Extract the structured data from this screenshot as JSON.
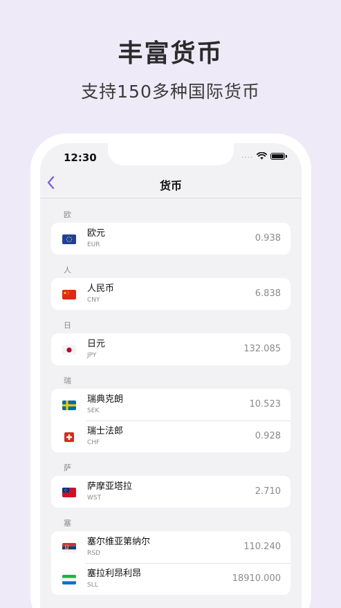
{
  "promo": {
    "title": "丰富货币",
    "subtitle": "支持150多种国际货币"
  },
  "status_bar": {
    "time": "12:30",
    "signal": "....",
    "icons": [
      "wifi-icon",
      "battery-icon"
    ]
  },
  "nav": {
    "title": "货币",
    "back_icon": "chevron-left-icon",
    "accent_color": "#7b61d8"
  },
  "sections": [
    {
      "header": "欧",
      "items": [
        {
          "name": "欧元",
          "code": "EUR",
          "rate": "0.938",
          "flag": "eu-flag-icon"
        }
      ]
    },
    {
      "header": "人",
      "items": [
        {
          "name": "人民币",
          "code": "CNY",
          "rate": "6.838",
          "flag": "china-flag-icon"
        }
      ]
    },
    {
      "header": "日",
      "items": [
        {
          "name": "日元",
          "code": "JPY",
          "rate": "132.085",
          "flag": "japan-flag-icon"
        }
      ]
    },
    {
      "header": "瑞",
      "items": [
        {
          "name": "瑞典克朗",
          "code": "SEK",
          "rate": "10.523",
          "flag": "sweden-flag-icon"
        },
        {
          "name": "瑞士法郎",
          "code": "CHF",
          "rate": "0.928",
          "flag": "switzerland-flag-icon"
        }
      ]
    },
    {
      "header": "萨",
      "items": [
        {
          "name": "萨摩亚塔拉",
          "code": "WST",
          "rate": "2.710",
          "flag": "samoa-flag-icon"
        }
      ]
    },
    {
      "header": "塞",
      "items": [
        {
          "name": "塞尔维亚第纳尔",
          "code": "RSD",
          "rate": "110.240",
          "flag": "serbia-flag-icon"
        },
        {
          "name": "塞拉利昂利昂",
          "code": "SLL",
          "rate": "18910.000",
          "flag": "sierra-leone-flag-icon"
        }
      ]
    }
  ]
}
